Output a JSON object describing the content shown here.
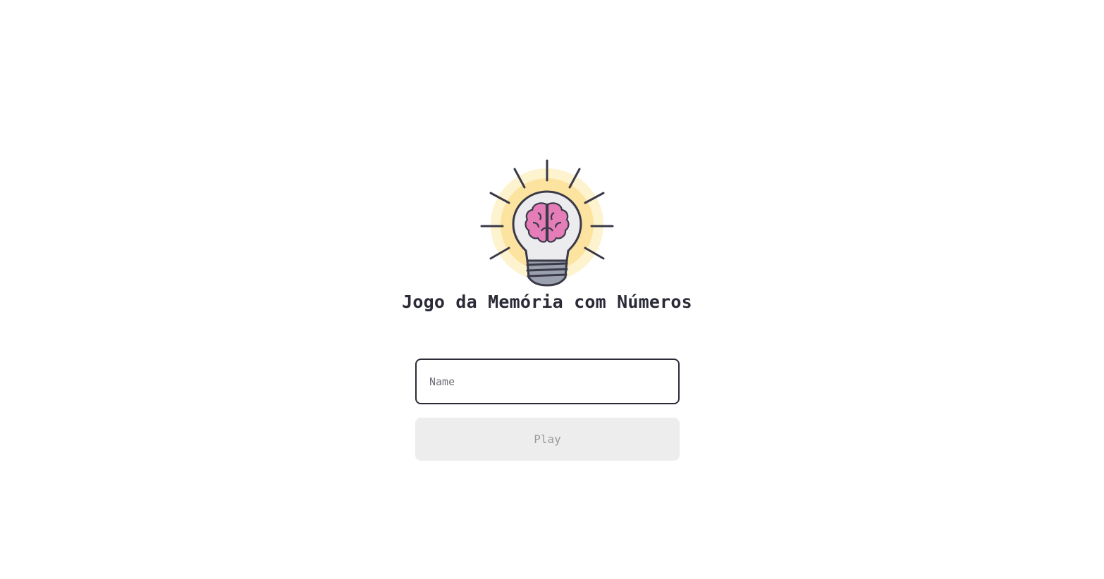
{
  "app": {
    "title": "Jogo da Memória com Números"
  },
  "logo": {
    "icon": "lightbulb-brain-icon",
    "colors": {
      "glow": "#fde9a8",
      "glow_inner": "#fcd66b",
      "outline": "#3a3a48",
      "bulb": "#ececef",
      "brain": "#e57db8",
      "base": "#9aa0ad"
    }
  },
  "form": {
    "name_placeholder": "Name",
    "name_value": "",
    "play_label": "Play",
    "play_enabled": false
  },
  "colors": {
    "text": "#2b2b38",
    "button_disabled_bg": "#ededed",
    "button_disabled_text": "#9a9a9a"
  }
}
